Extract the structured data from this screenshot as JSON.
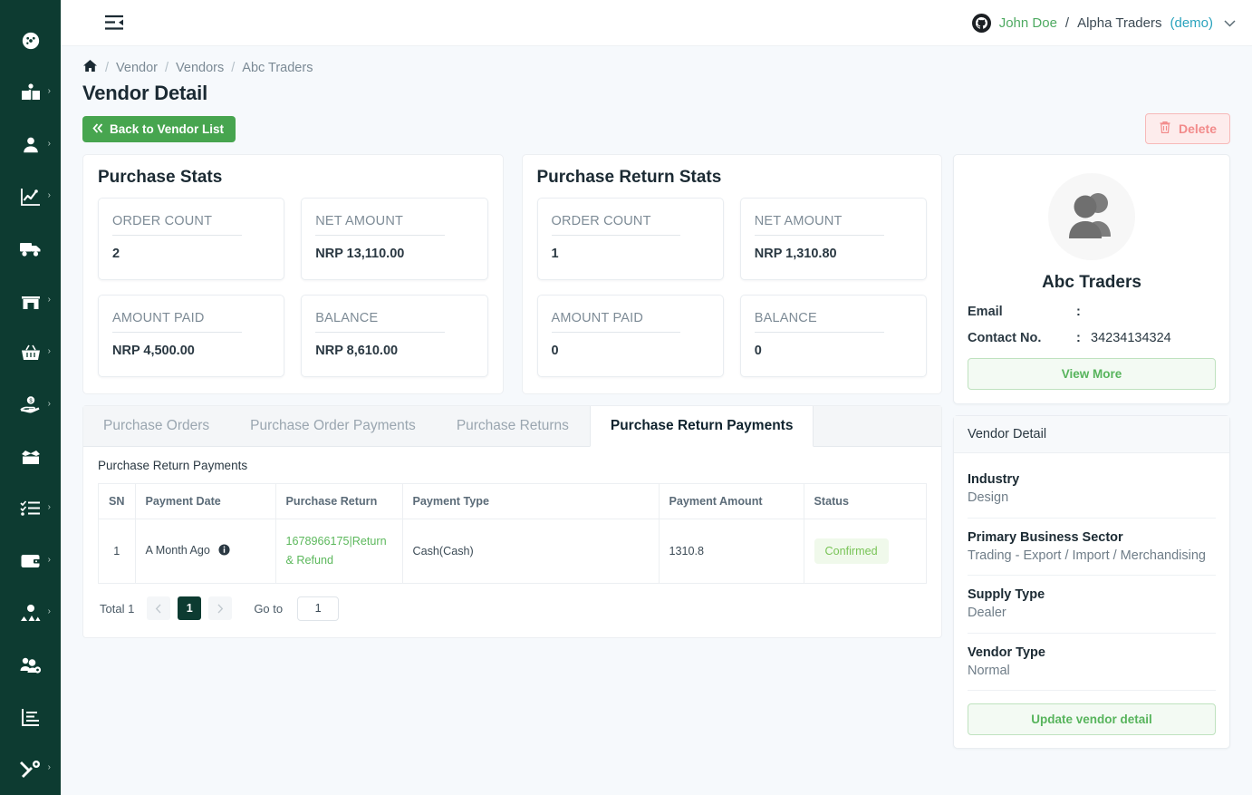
{
  "sidebar": {
    "items": [
      {
        "name": "dashboard",
        "icon": "gauge-icon",
        "caret": false
      },
      {
        "name": "catalog",
        "icon": "book-open-icon",
        "caret": true
      },
      {
        "name": "customer",
        "icon": "user-icon",
        "caret": true
      },
      {
        "name": "sales-analytics",
        "icon": "line-chart-icon",
        "caret": true
      },
      {
        "name": "delivery",
        "icon": "truck-icon",
        "caret": false
      },
      {
        "name": "store",
        "icon": "storefront-icon",
        "caret": true
      },
      {
        "name": "purchase",
        "icon": "shopping-basket-icon",
        "caret": true
      },
      {
        "name": "payment",
        "icon": "hand-dollar-icon",
        "caret": true
      },
      {
        "name": "inventory",
        "icon": "open-box-icon",
        "caret": true
      },
      {
        "name": "tasks",
        "icon": "checklist-icon",
        "caret": true
      },
      {
        "name": "wallet",
        "icon": "wallet-icon",
        "caret": true
      },
      {
        "name": "vendor",
        "icon": "people-icon",
        "caret": true
      },
      {
        "name": "user-management",
        "icon": "users-cog-icon",
        "caret": false
      },
      {
        "name": "reports",
        "icon": "bar-report-icon",
        "caret": false
      },
      {
        "name": "settings",
        "icon": "tools-icon",
        "caret": true
      }
    ]
  },
  "topbar": {
    "menu_icon": "menu-collapse-icon",
    "avatar_icon": "github-avatar-icon",
    "user_name": "John Doe",
    "separator": "/",
    "org_name": "Alpha Traders",
    "org_mode": "(demo)",
    "chevron": "⌄"
  },
  "breadcrumb": {
    "home_icon": "home-icon",
    "items": [
      "Vendor",
      "Vendors",
      "Abc Traders"
    ],
    "separator": "/"
  },
  "page": {
    "title": "Vendor Detail",
    "back_button": "Back to Vendor List",
    "back_icon": "double-chevron-left-icon",
    "delete_button": "Delete",
    "delete_icon": "trash-icon"
  },
  "purchase_stats": {
    "title": "Purchase Stats",
    "cards": [
      {
        "label": "ORDER COUNT",
        "value": "2"
      },
      {
        "label": "NET AMOUNT",
        "value": "NRP 13,110.00"
      },
      {
        "label": "AMOUNT PAID",
        "value": "NRP 4,500.00"
      },
      {
        "label": "BALANCE",
        "value": "NRP 8,610.00"
      }
    ]
  },
  "purchase_return_stats": {
    "title": "Purchase Return Stats",
    "cards": [
      {
        "label": "ORDER COUNT",
        "value": "1"
      },
      {
        "label": "NET AMOUNT",
        "value": "NRP 1,310.80"
      },
      {
        "label": "AMOUNT PAID",
        "value": "0"
      },
      {
        "label": "BALANCE",
        "value": "0"
      }
    ]
  },
  "tabs": [
    {
      "label": "Purchase Orders",
      "active": false
    },
    {
      "label": "Purchase Order Payments",
      "active": false
    },
    {
      "label": "Purchase Returns",
      "active": false
    },
    {
      "label": "Purchase Return Payments",
      "active": true
    }
  ],
  "table": {
    "caption": "Purchase Return Payments",
    "columns": [
      "SN",
      "Payment Date",
      "Purchase Return",
      "Payment Type",
      "Payment Amount",
      "Status"
    ],
    "rows": [
      {
        "sn": "1",
        "payment_date": "A Month Ago",
        "date_info_icon": "info-circle-icon",
        "purchase_return": "1678966175|Return & Refund",
        "payment_type": "Cash(Cash)",
        "payment_amount": "1310.8",
        "status": "Confirmed"
      }
    ]
  },
  "pagination": {
    "total_label": "Total 1",
    "prev_icon": "chevron-left-icon",
    "next_icon": "chevron-right-icon",
    "current_page": "1",
    "goto_label": "Go to",
    "goto_value": "1"
  },
  "vendor_card": {
    "avatar_icon": "group-avatar-icon",
    "name": "Abc Traders",
    "email_label": "Email",
    "email_value": "",
    "contact_label": "Contact No.",
    "contact_value": "34234134324",
    "colon": ":",
    "view_more": "View More"
  },
  "vendor_detail": {
    "heading": "Vendor Detail",
    "rows": [
      {
        "label": "Industry",
        "value": "Design"
      },
      {
        "label": "Primary Business Sector",
        "value": "Trading - Export / Import / Merchandising"
      },
      {
        "label": "Supply Type",
        "value": "Dealer"
      },
      {
        "label": "Vendor Type",
        "value": "Normal"
      }
    ],
    "update_button": "Update vendor detail"
  },
  "colors": {
    "sidebar": "#0d3b31",
    "primary_green": "#47a54f",
    "link_green": "#5cb85c",
    "badge_bg": "#f0f9eb",
    "badge_text": "#79c457",
    "danger": "#f28b8b",
    "page_bg": "#f6f9fc"
  }
}
